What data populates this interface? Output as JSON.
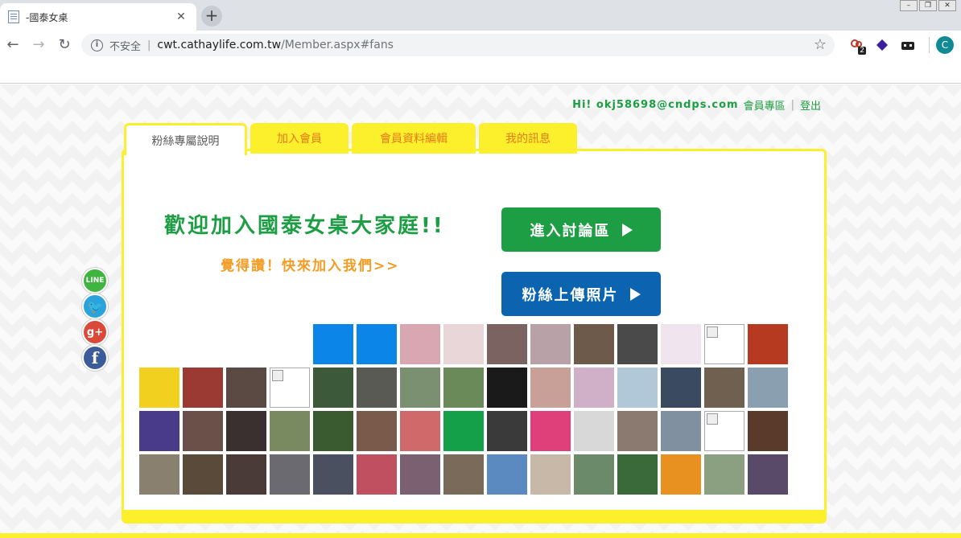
{
  "browser": {
    "tab_title": "-國泰女桌",
    "tab_close": "✕",
    "new_tab": "+",
    "insecure_label": "不安全",
    "url_host": "cwt.cathaylife.com.tw",
    "url_path": "/Member.aspx#fans",
    "extension_badge": "2",
    "profile_initial": "C"
  },
  "userbar": {
    "greeting": "Hi! okj58698@cndps.com",
    "member_zone": "會員專區",
    "divider": "|",
    "logout": "登出"
  },
  "tabs": [
    {
      "label": "粉絲專屬說明",
      "active": true
    },
    {
      "label": "加入會員",
      "active": false
    },
    {
      "label": "會員資料編輯",
      "active": false
    },
    {
      "label": "我的訊息",
      "active": false
    }
  ],
  "content": {
    "headline": "歡迎加入國泰女桌大家庭!!",
    "subline": "覺得讚！快來加入我們>>",
    "forum_button": "進入討論區",
    "upload_button": "粉絲上傳照片"
  },
  "social": [
    {
      "name": "line-icon",
      "glyph": "LINE"
    },
    {
      "name": "twitter-icon",
      "glyph": "🐦"
    },
    {
      "name": "googleplus-icon",
      "glyph": "g+"
    },
    {
      "name": "facebook-icon",
      "glyph": "f"
    }
  ],
  "fan_photos": [
    "blank",
    "blank",
    "blank",
    "blank",
    "#0b86e8",
    "#0b86e8",
    "#d9a7b1",
    "#e8d6d8",
    "#7a6360",
    "#b8a2a8",
    "#6e5a4a",
    "#4a4a4a",
    "#f0e4ee",
    "broken",
    "#b53a20",
    "#f2d020",
    "#9b3a32",
    "#5b4a44",
    "broken",
    "#3c5a3a",
    "#5a5a55",
    "#7a9070",
    "#6a8a5a",
    "#1a1a1a",
    "#c8a098",
    "#d0b0c8",
    "#b0c8d8",
    "#3a4a60",
    "#706050",
    "#8aa0b0",
    "#4a3a8a",
    "#6a5048",
    "#3a3030",
    "#7a8a60",
    "#3a5a30",
    "#7a5a4a",
    "#d06a6a",
    "#14a048",
    "#3a3a3a",
    "#e0407a",
    "#d8d8d8",
    "#8a7a70",
    "#8090a0",
    "broken",
    "#5a3a2a",
    "#8a8070",
    "#5a4a3a",
    "#4a3a38",
    "#6a6a70",
    "#4a5060",
    "#c05060",
    "#7a6070",
    "#7a6a5a",
    "#5a8ac0",
    "#c8b8a8",
    "#6a8a6a",
    "#3a6a3a",
    "#e89020",
    "#8aa080",
    "#5a4a6a"
  ]
}
